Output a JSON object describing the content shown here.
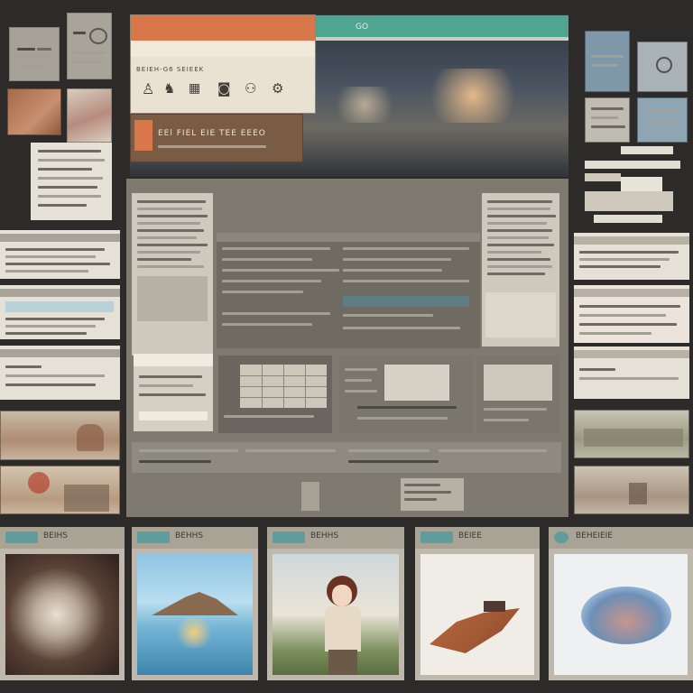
{
  "hero": {
    "tab_label": "GO",
    "card_subtitle": "BEIEH-G6 SEIEEK",
    "card_footer_text": "EEl FIEL EIE TEE EEEO"
  },
  "thumbnails": [
    {
      "label": "BEIHS"
    },
    {
      "label": "BEHHS"
    },
    {
      "label": "BEHHS"
    },
    {
      "label": "BEIEE"
    },
    {
      "label": "BEHEIEIE"
    }
  ],
  "colors": {
    "background": "#2c2b29",
    "accent_orange": "#d9774a",
    "accent_teal": "#4fa58f",
    "panel": "#7f7a70"
  },
  "icons": [
    "person-icon",
    "camera-icon",
    "grid-icon",
    "globe-icon",
    "car-icon",
    "settings-icon"
  ]
}
